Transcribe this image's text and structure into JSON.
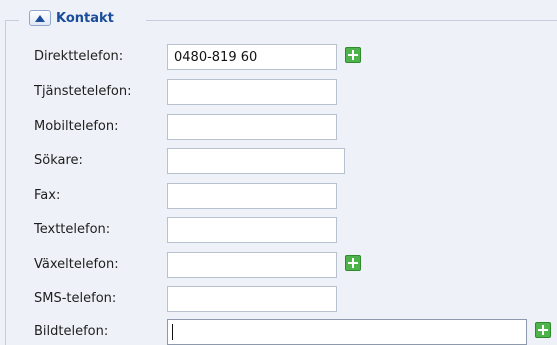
{
  "section": {
    "title": "Kontakt"
  },
  "fields": [
    {
      "label": "Direkttelefon:",
      "value": "0480-819 60",
      "placeholder": "",
      "has_add": true
    },
    {
      "label": "Tjänstetelefon:",
      "value": "",
      "placeholder": "",
      "has_add": false
    },
    {
      "label": "Mobiltelefon:",
      "value": "",
      "placeholder": "",
      "has_add": false
    },
    {
      "label": "Sökare:",
      "value": "",
      "placeholder": "",
      "has_add": false
    },
    {
      "label": "Fax:",
      "value": "",
      "placeholder": "",
      "has_add": false
    },
    {
      "label": "Texttelefon:",
      "value": "",
      "placeholder": "",
      "has_add": false
    },
    {
      "label": "Växeltelefon:",
      "value": "",
      "placeholder": "",
      "has_add": true
    },
    {
      "label": "SMS-telefon:",
      "value": "",
      "placeholder": "",
      "has_add": false
    },
    {
      "label": "Bildtelefon:",
      "value": "",
      "placeholder": "",
      "has_add": true
    }
  ],
  "icons": {
    "collapse": "collapse-up-icon",
    "add": "add-plus-icon"
  },
  "colors": {
    "panel_background": "#eef2f8",
    "legend_title": "#1b4d9a",
    "add_button": "#4fb34b",
    "field_border": "#b8c2cf"
  }
}
